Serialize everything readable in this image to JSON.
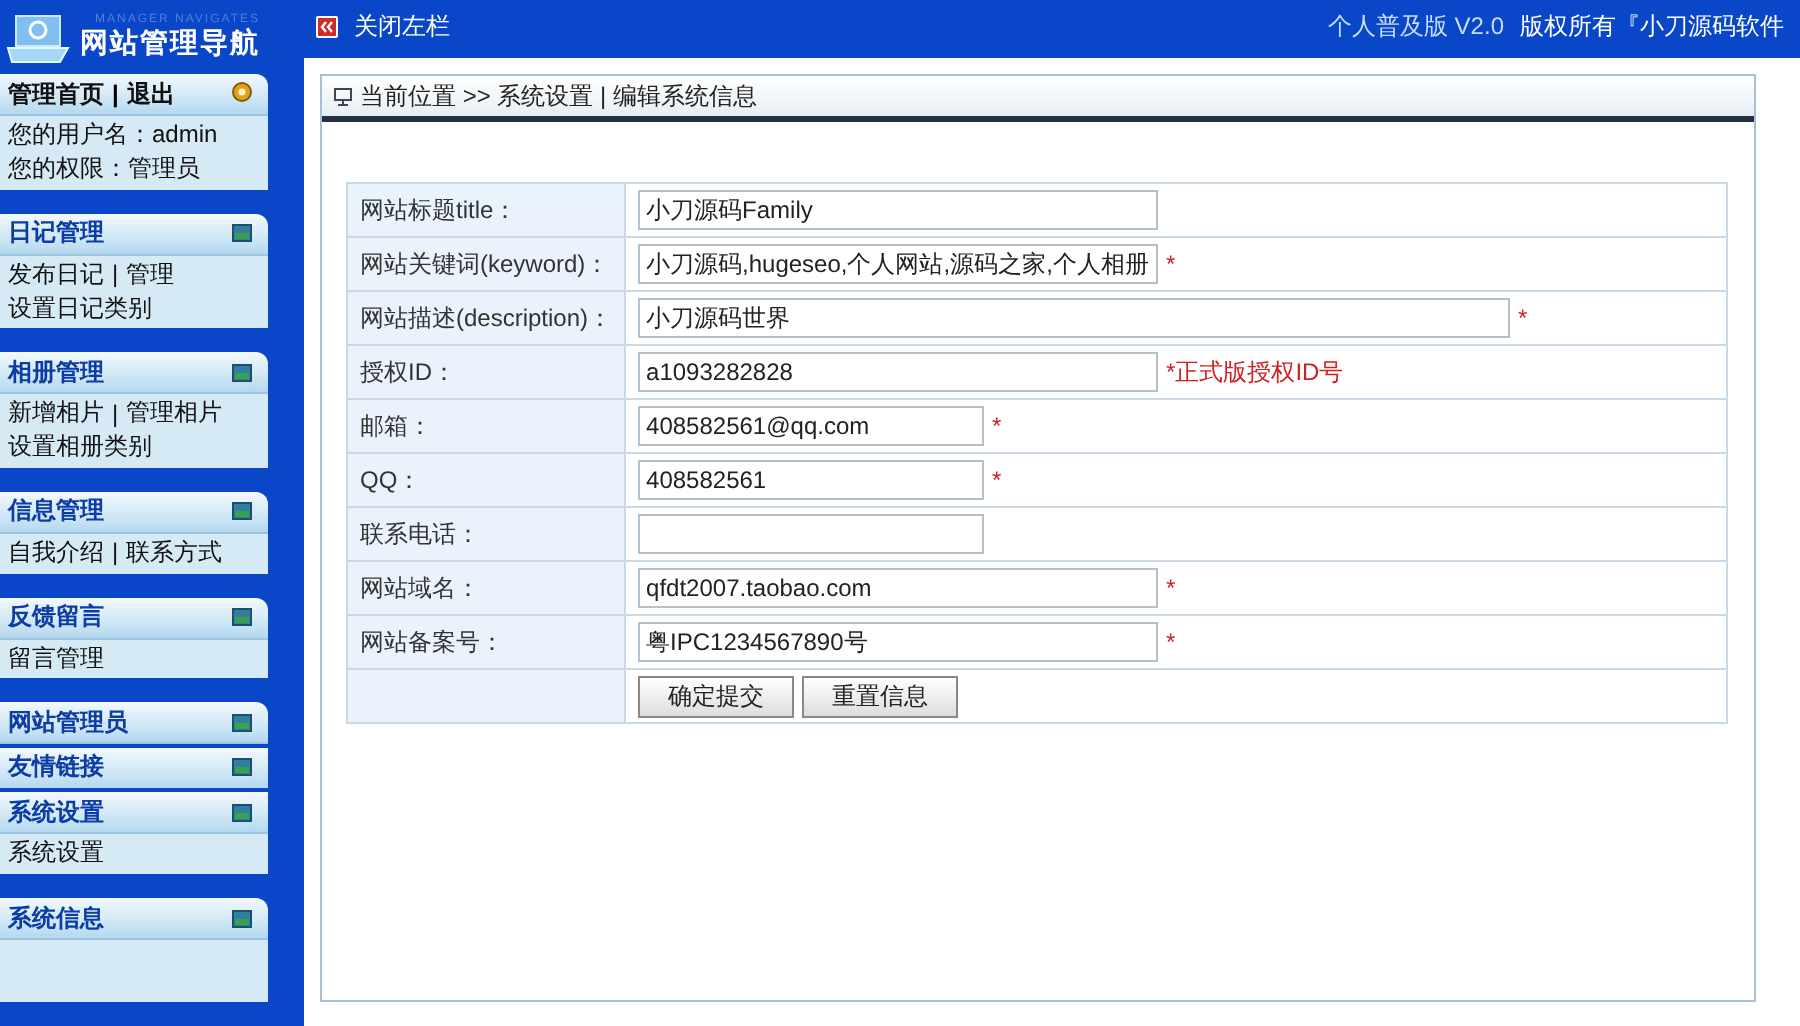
{
  "header": {
    "logo_title": "网站管理导航",
    "logo_subtitle": "MANAGER NAVIGATES",
    "toggle_label": "关闭左栏",
    "edition": "个人普及版 V2.0",
    "copyright": "版权所有『小刀源码软件"
  },
  "sidebar": {
    "account": {
      "links": [
        "管理首页",
        "|",
        "退出"
      ],
      "lines": [
        "您的用户名：admin",
        "您的权限：管理员"
      ]
    },
    "sections": [
      {
        "title": "日记管理",
        "joined": false,
        "rows": [
          [
            "发布日记",
            "|",
            "管理"
          ],
          [
            "设置日记类别"
          ]
        ]
      },
      {
        "title": "相册管理",
        "joined": false,
        "rows": [
          [
            "新增相片",
            "|",
            "管理相片"
          ],
          [
            "设置相册类别"
          ]
        ]
      },
      {
        "title": "信息管理",
        "joined": false,
        "rows": [
          [
            "自我介绍",
            "|",
            "联系方式"
          ]
        ]
      },
      {
        "title": "反馈留言",
        "joined": false,
        "rows": [
          [
            "留言管理"
          ]
        ]
      },
      {
        "title": "网站管理员",
        "joined": false
      },
      {
        "title": "友情链接",
        "joined": true
      },
      {
        "title": "系统设置",
        "joined": true,
        "rows": [
          [
            "系统设置"
          ]
        ]
      },
      {
        "title": "系统信息",
        "joined": false
      }
    ]
  },
  "breadcrumb": "当前位置 >> 系统设置 | 编辑系统信息",
  "form": {
    "rows": [
      {
        "label": "网站标题title：",
        "value": "小刀源码Family",
        "kind": "medium"
      },
      {
        "label": "网站关键词(keyword)：",
        "value": "小刀源码,hugeseo,个人网站,源码之家,个人相册",
        "kind": "medium",
        "mark": "*"
      },
      {
        "label": "网站描述(description)：",
        "value": "小刀源码世界",
        "kind": "long",
        "mark": "*"
      },
      {
        "label": "授权ID：",
        "value": "a1093282828",
        "kind": "medium",
        "hint": "*正式版授权ID号"
      },
      {
        "label": "邮箱：",
        "value": "408582561@qq.com",
        "kind": "short",
        "mark": "*"
      },
      {
        "label": "QQ：",
        "value": "408582561",
        "kind": "short",
        "mark": "*"
      },
      {
        "label": "联系电话：",
        "kind": "short"
      },
      {
        "label": "网站域名：",
        "value": "qfdt2007.taobao.com",
        "kind": "medium",
        "mark": "*"
      },
      {
        "label": "网站备案号：",
        "value": "粤IPC1234567890号",
        "kind": "medium",
        "mark": "*"
      }
    ],
    "buttons": [
      "确定提交",
      "重置信息"
    ]
  }
}
